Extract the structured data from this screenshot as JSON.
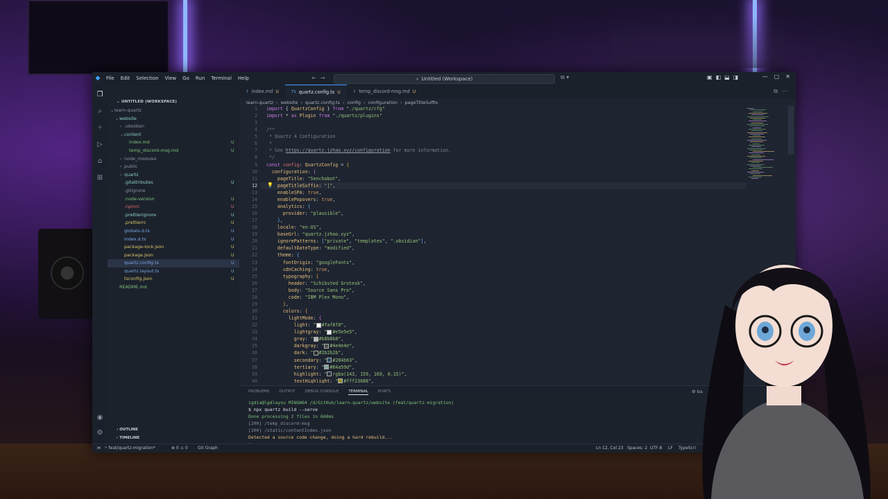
{
  "titlebar": {
    "menu": [
      "File",
      "Edit",
      "Selection",
      "View",
      "Go",
      "Run",
      "Terminal",
      "Help"
    ],
    "command_center": "Untitled (Workspace)"
  },
  "sidebar": {
    "header": "UNTITLED (WORKSPACE)",
    "items": [
      {
        "label": "learn-quartz",
        "badge": "",
        "color": "c-dim",
        "indent": 0,
        "chev": "⌄"
      },
      {
        "label": "website",
        "badge": "",
        "color": "c-teal",
        "indent": 1,
        "chev": "⌄"
      },
      {
        "label": ".obsidian",
        "badge": "",
        "color": "c-dim",
        "indent": 2,
        "chev": "›"
      },
      {
        "label": "content",
        "badge": "",
        "color": "c-teal",
        "indent": 2,
        "chev": "⌄"
      },
      {
        "label": "index.md",
        "badge": "U",
        "color": "c-green",
        "indent": 3,
        "chev": ""
      },
      {
        "label": "temp_discord-msg.md",
        "badge": "U",
        "color": "c-green",
        "indent": 3,
        "chev": ""
      },
      {
        "label": "node_modules",
        "badge": "",
        "color": "c-dim",
        "indent": 2,
        "chev": "›"
      },
      {
        "label": "public",
        "badge": "",
        "color": "c-dim",
        "indent": 2,
        "chev": "›"
      },
      {
        "label": "quartz",
        "badge": "",
        "color": "c-teal",
        "indent": 2,
        "chev": "›"
      },
      {
        "label": ".gitattributes",
        "badge": "U",
        "color": "c-teal",
        "indent": 2,
        "chev": ""
      },
      {
        "label": ".gitignore",
        "badge": "",
        "color": "c-dim",
        "indent": 2,
        "chev": ""
      },
      {
        "label": ".node-version",
        "badge": "U",
        "color": "c-green",
        "indent": 2,
        "chev": ""
      },
      {
        "label": ".npmrc",
        "badge": "U",
        "color": "c-red",
        "indent": 2,
        "chev": ""
      },
      {
        "label": ".prettierignore",
        "badge": "U",
        "color": "c-teal",
        "indent": 2,
        "chev": ""
      },
      {
        "label": ".prettierrc",
        "badge": "U",
        "color": "c-yel",
        "indent": 2,
        "chev": ""
      },
      {
        "label": "globals.d.ts",
        "badge": "U",
        "color": "c-blue",
        "indent": 2,
        "chev": ""
      },
      {
        "label": "index.d.ts",
        "badge": "U",
        "color": "c-blue",
        "indent": 2,
        "chev": ""
      },
      {
        "label": "package-lock.json",
        "badge": "U",
        "color": "c-yel",
        "indent": 2,
        "chev": ""
      },
      {
        "label": "package.json",
        "badge": "U",
        "color": "c-yel",
        "indent": 2,
        "chev": ""
      },
      {
        "label": "quartz.config.ts",
        "badge": "U",
        "color": "c-blue",
        "indent": 2,
        "chev": "",
        "selected": true
      },
      {
        "label": "quartz.layout.ts",
        "badge": "U",
        "color": "c-blue",
        "indent": 2,
        "chev": ""
      },
      {
        "label": "tsconfig.json",
        "badge": "U",
        "color": "c-yel",
        "indent": 2,
        "chev": ""
      },
      {
        "label": "README.md",
        "badge": "",
        "color": "c-green",
        "indent": 1,
        "chev": ""
      }
    ],
    "outline": "OUTLINE",
    "timeline": "TIMELINE"
  },
  "tabs": [
    {
      "label": "index.md",
      "badge": "U",
      "active": false
    },
    {
      "label": "quartz.config.ts",
      "badge": "U",
      "active": true
    },
    {
      "label": "temp_discord-msg.md",
      "badge": "U",
      "active": false
    }
  ],
  "breadcrumb": [
    "learn-quartz",
    "website",
    "quartz.config.ts",
    "config",
    "configuration",
    "pageTitleSuffix"
  ],
  "editor": {
    "current_line": 12,
    "lines": [
      "<span class=kw>import</span> { <span class=typ>QuartzConfig</span> } <span class=kw>from</span> <span class=str>\"./quartz/cfg\"</span>",
      "<span class=kw>import</span> * <span class=kw>as</span> <span class=typ>Plugin</span> <span class=kw>from</span> <span class=str>\"./quartz/plugins\"</span>",
      "",
      "<span class=cm>/**</span>",
      "<span class=cm> * Quartz 4 Configuration</span>",
      "<span class=cm> *</span>",
      "<span class=cm> * See </span><span class=url>https://quartz.jzhao.xyz/configuration</span><span class=cm> for more information.</span>",
      "<span class=cm> */</span>",
      "<span class=kw>const</span> <span class=var>config</span>: <span class=typ>QuartzConfig</span> = <span class=br>{</span>",
      "  <span class=prop>configuration</span>: <span class=br2>{</span>",
      "    <span class=prop>pageTitle</span>: <span class=str>\"Senchabot\"</span>,",
      "    <span class=prop>pageTitleSuffix</span>: <span class=str>\"|\"</span>,",
      "    <span class=prop>enableSPA</span>: <span class=bool>true</span>,",
      "    <span class=prop>enablePopovers</span>: <span class=bool>true</span>,",
      "    <span class=prop>analytics</span>: <span class=br3>{</span>",
      "      <span class=prop>provider</span>: <span class=str>\"plausible\"</span>,",
      "    <span class=br3>}</span>,",
      "    <span class=prop>locale</span>: <span class=str>\"en-US\"</span>,",
      "    <span class=prop>baseUrl</span>: <span class=str>\"quartz.jzhao.xyz\"</span>,",
      "    <span class=prop>ignorePatterns</span>: <span class=br3>[</span><span class=str>\"private\"</span>, <span class=str>\"templates\"</span>, <span class=str>\".obsidian\"</span><span class=br3>]</span>,",
      "    <span class=prop>defaultDateType</span>: <span class=str>\"modified\"</span>,",
      "    <span class=prop>theme</span>: <span class=br3>{</span>",
      "      <span class=prop>fontOrigin</span>: <span class=str>\"googleFonts\"</span>,",
      "      <span class=prop>cdnCaching</span>: <span class=bool>true</span>,",
      "      <span class=prop>typography</span>: <span class=br>{</span>",
      "        <span class=prop>header</span>: <span class=str>\"Schibsted Grotesk\"</span>,",
      "        <span class=prop>body</span>: <span class=str>\"Source Sans Pro\"</span>,",
      "        <span class=prop>code</span>: <span class=str>\"IBM Plex Mono\"</span>,",
      "      <span class=br>}</span>,",
      "      <span class=prop>colors</span>: <span class=br>{</span>",
      "        <span class=prop>lightMode</span>: <span class=br2>{</span>",
      "          <span class=prop>light</span>: <span class=str>\"<i class=sw style='background:#faf8f8'></i>#faf8f8\"</span>,",
      "          <span class=prop>lightgray</span>: <span class=str>\"<i class=sw style='background:#e5e5e5'></i>#e5e5e5\"</span>,",
      "          <span class=prop>gray</span>: <span class=str>\"<i class=sw style='background:#b8b8b8'></i>#b8b8b8\"</span>,",
      "          <span class=prop>darkgray</span>: <span class=str>\"<i class=sw style='background:#4e4e4e'></i>#4e4e4e\"</span>,",
      "          <span class=prop>dark</span>: <span class=str>\"<i class=sw style='background:#2b2b2b'></i>#2b2b2b\"</span>,",
      "          <span class=prop>secondary</span>: <span class=str>\"<i class=sw style='background:#284b63'></i>#284b63\"</span>,",
      "          <span class=prop>tertiary</span>: <span class=str>\"<i class=sw style='background:#84a59d'></i>#84a59d\"</span>,",
      "          <span class=prop>highlight</span>: <span class=str>\"<i class=sw style='background:rgba(143,159,169,0.15)'></i>rgba(143, 159, 169, 0.15)\"</span>,",
      "          <span class=prop>textHighlight</span>: <span class=str>\"<i class=sw style='background:#fff23688'></i>#fff23688\"</span>,"
    ]
  },
  "panel": {
    "tabs": [
      "PROBLEMS",
      "OUTPUT",
      "DEBUG CONSOLE",
      "TERMINAL",
      "PORTS"
    ],
    "active_tab": "TERMINAL",
    "right_label": "ba",
    "terminal": [
      {
        "text": "igdia@lgdlaysu MINGW64 /d/GitHub/learn-quartz/website (feat/quartz-migration)",
        "color": "#7ec27a"
      },
      {
        "text": "$ npx quartz build --serve",
        "color": "#dfe4ea"
      },
      {
        "text": "Done processing 2 files in 660ms",
        "color": "#7ec27a"
      },
      {
        "text": "[200] /temp_discord-msg",
        "color": "#8b93a1"
      },
      {
        "text": "[200] /static/contentIndex.json",
        "color": "#8b93a1"
      },
      {
        "text": "Detected a source code change, doing a hard rebuild...",
        "color": "#e5c07b"
      },
      {
        "text": "▯",
        "color": "#8b93a1"
      }
    ]
  },
  "status": {
    "branch": "feat/quartz-migration*",
    "problems": "⊗ 0 ⚠ 0",
    "git_graph": "Git Graph",
    "position": "Ln 12, Col 23",
    "spaces": "Spaces: 2",
    "encoding": "UTF-8",
    "eol": "LF",
    "language": "TypeScri"
  },
  "colors": {
    "accent": "#3ea0ff",
    "editor_bg": "#1e2430",
    "sidebar_bg": "#1c222c"
  }
}
